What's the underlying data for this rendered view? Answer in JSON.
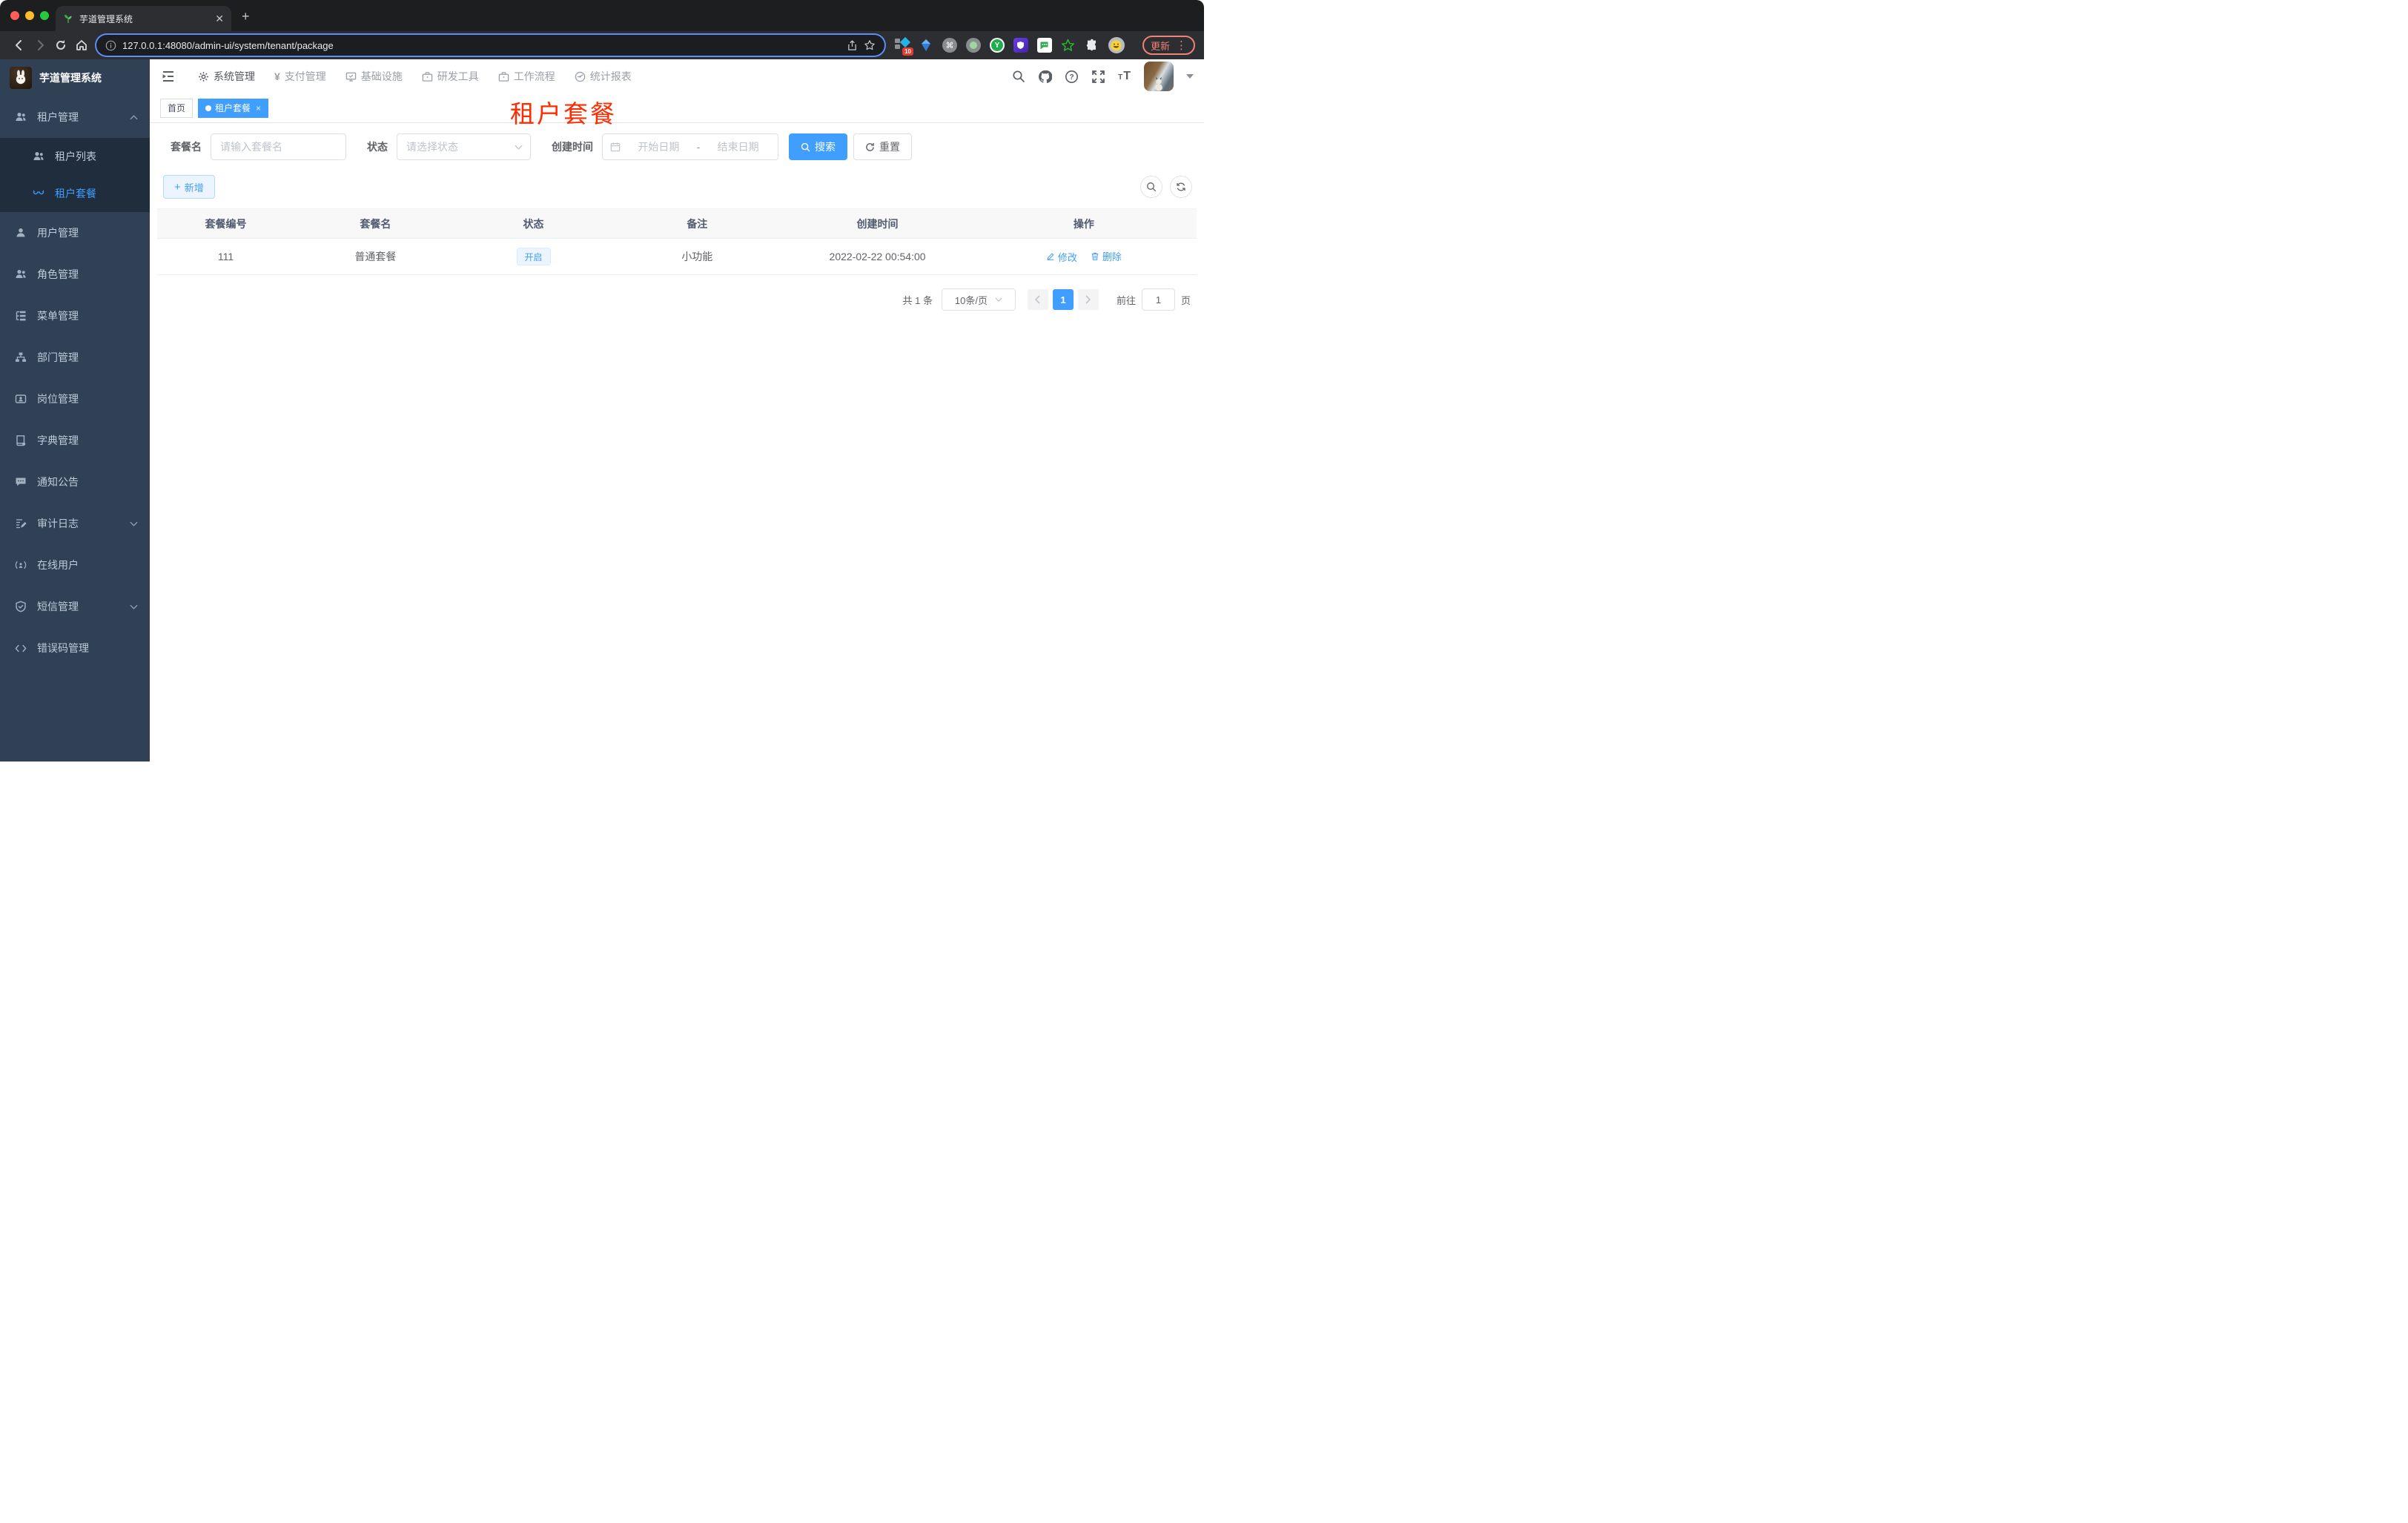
{
  "colors": {
    "accent": "#409eff",
    "sidebar_bg": "#304156",
    "sidebar_submenu_bg": "#1f2d3d",
    "sidebar_text": "#bfcbd9",
    "annotation_red": "#fe2c00",
    "status_tag_bg": "#ecf5ff",
    "tag_active_bg": "#409eff",
    "update_chip": "#ee8277"
  },
  "browser": {
    "tab": {
      "title": "芋道管理系统"
    },
    "url": "127.0.0.1:48080/admin-ui/system/tenant/package",
    "extensions_badge": "10",
    "update_button": "更新"
  },
  "app": {
    "logo": {
      "title": "芋道管理系统"
    },
    "top_menu": {
      "items": [
        {
          "label": "系统管理",
          "icon": "gear-icon",
          "active": true
        },
        {
          "label": "支付管理",
          "icon": "yen-icon",
          "active": false
        },
        {
          "label": "基础设施",
          "icon": "monitor-icon",
          "active": false
        },
        {
          "label": "研发工具",
          "icon": "briefcase-icon",
          "active": false
        },
        {
          "label": "工作流程",
          "icon": "briefcase-icon",
          "active": false
        },
        {
          "label": "统计报表",
          "icon": "dashboard-icon",
          "active": false
        }
      ]
    },
    "sidebar": {
      "items": [
        {
          "label": "租户管理",
          "icon": "peoples-icon",
          "expanded": true
        },
        {
          "label": "租户列表",
          "icon": "peoples-icon",
          "submenu": true,
          "active": false
        },
        {
          "label": "租户套餐",
          "icon": "glasses-icon",
          "submenu": true,
          "active": true
        },
        {
          "label": "用户管理",
          "icon": "user-icon"
        },
        {
          "label": "角色管理",
          "icon": "peoples-icon"
        },
        {
          "label": "菜单管理",
          "icon": "tree-table-icon"
        },
        {
          "label": "部门管理",
          "icon": "tree-icon"
        },
        {
          "label": "岗位管理",
          "icon": "post-icon"
        },
        {
          "label": "字典管理",
          "icon": "dict-icon"
        },
        {
          "label": "通知公告",
          "icon": "message-icon"
        },
        {
          "label": "审计日志",
          "icon": "log-icon",
          "collapsible": true
        },
        {
          "label": "在线用户",
          "icon": "online-icon"
        },
        {
          "label": "短信管理",
          "icon": "sms-shield-icon",
          "collapsible": true
        },
        {
          "label": "错误码管理",
          "icon": "code-icon"
        }
      ]
    },
    "tags": {
      "items": [
        {
          "label": "首页",
          "active": false
        },
        {
          "label": "租户套餐",
          "active": true,
          "closable": true
        }
      ]
    },
    "annotation": "租户套餐",
    "search": {
      "fields": [
        {
          "label": "套餐名",
          "placeholder": "请输入套餐名"
        },
        {
          "label": "状态",
          "placeholder": "请选择状态"
        },
        {
          "label": "创建时间",
          "start_placeholder": "开始日期",
          "separator": "-",
          "end_placeholder": "结束日期"
        }
      ],
      "search_button": "搜索",
      "reset_button": "重置"
    },
    "table_toolbar": {
      "add_button": "新增"
    },
    "table": {
      "headers": [
        "套餐编号",
        "套餐名",
        "状态",
        "备注",
        "创建时间",
        "操作"
      ],
      "rows": [
        {
          "id": "111",
          "name": "普通套餐",
          "status": "开启",
          "remark": "小功能",
          "created_at": "2022-02-22 00:54:00",
          "action_edit": "修改",
          "action_delete": "删除"
        }
      ]
    },
    "pagination": {
      "total": "共 1 条",
      "page_size": "10条/页",
      "current_page": "1",
      "goto_label": "前往",
      "goto_value": "1",
      "page_unit": "页"
    }
  }
}
